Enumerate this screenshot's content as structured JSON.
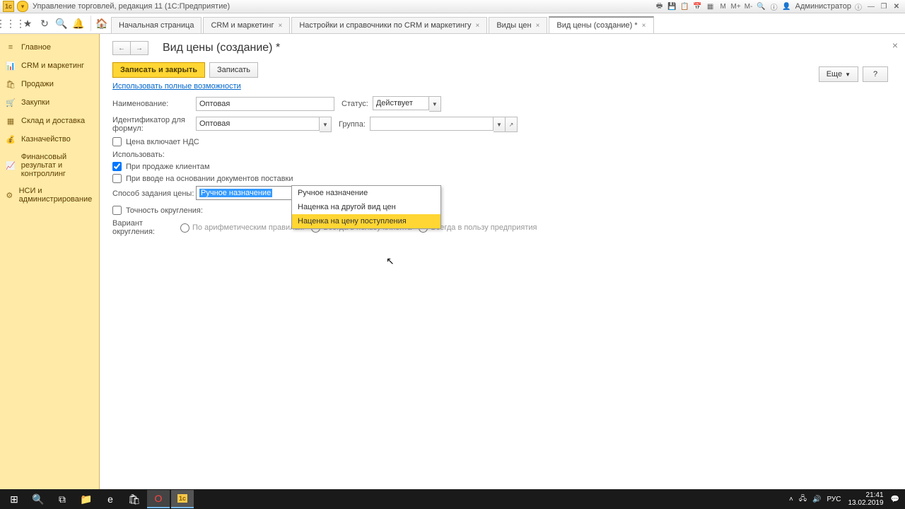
{
  "titlebar": {
    "app_title": "Управление торговлей, редакция 11  (1С:Предприятие)",
    "user_label": "Администратор"
  },
  "toolbar_tabs": [
    {
      "label": "Начальная страница",
      "closable": false
    },
    {
      "label": "CRM и маркетинг",
      "closable": true
    },
    {
      "label": "Настройки и справочники по CRM и маркетингу",
      "closable": true
    },
    {
      "label": "Виды цен",
      "closable": true
    },
    {
      "label": "Вид цены (создание) *",
      "closable": true,
      "active": true
    }
  ],
  "sidebar": [
    {
      "icon": "≡",
      "label": "Главное"
    },
    {
      "icon": "📊",
      "label": "CRM и маркетинг"
    },
    {
      "icon": "🛍",
      "label": "Продажи"
    },
    {
      "icon": "🛒",
      "label": "Закупки"
    },
    {
      "icon": "▦",
      "label": "Склад и доставка"
    },
    {
      "icon": "💰",
      "label": "Казначейство"
    },
    {
      "icon": "📈",
      "label": "Финансовый результат и контроллинг"
    },
    {
      "icon": "⚙",
      "label": "НСИ и администрирование"
    }
  ],
  "page": {
    "title": "Вид цены (создание) *",
    "btn_save_close": "Записать и закрыть",
    "btn_save": "Записать",
    "btn_more": "Еще",
    "btn_help": "?",
    "link_full": "Использовать полные возможности",
    "lbl_name": "Наименование:",
    "val_name": "Оптовая",
    "lbl_status": "Статус:",
    "val_status": "Действует",
    "lbl_id": "Идентификатор для формул:",
    "val_id": "Оптовая",
    "lbl_group": "Группа:",
    "val_group": "",
    "chk_vat": "Цена включает НДС",
    "lbl_use": "Использовать:",
    "chk_sale": "При продаже клиентам",
    "chk_supply": "При вводе на основании документов поставки",
    "lbl_method": "Способ задания цены:",
    "val_method": "Ручное назначение",
    "chk_round": "Точность округления:",
    "lbl_round_variant": "Вариант округления:",
    "radio_arith": "По арифметическим правилам",
    "radio_client": "Всегда в пользу клиента",
    "radio_enterprise": "Всегда в пользу предприятия",
    "dropdown": [
      "Ручное назначение",
      "Наценка на другой вид цен",
      "Наценка на цену поступления"
    ]
  },
  "taskbar": {
    "lang": "РУС",
    "time": "21:41",
    "date": "13.02.2019"
  }
}
